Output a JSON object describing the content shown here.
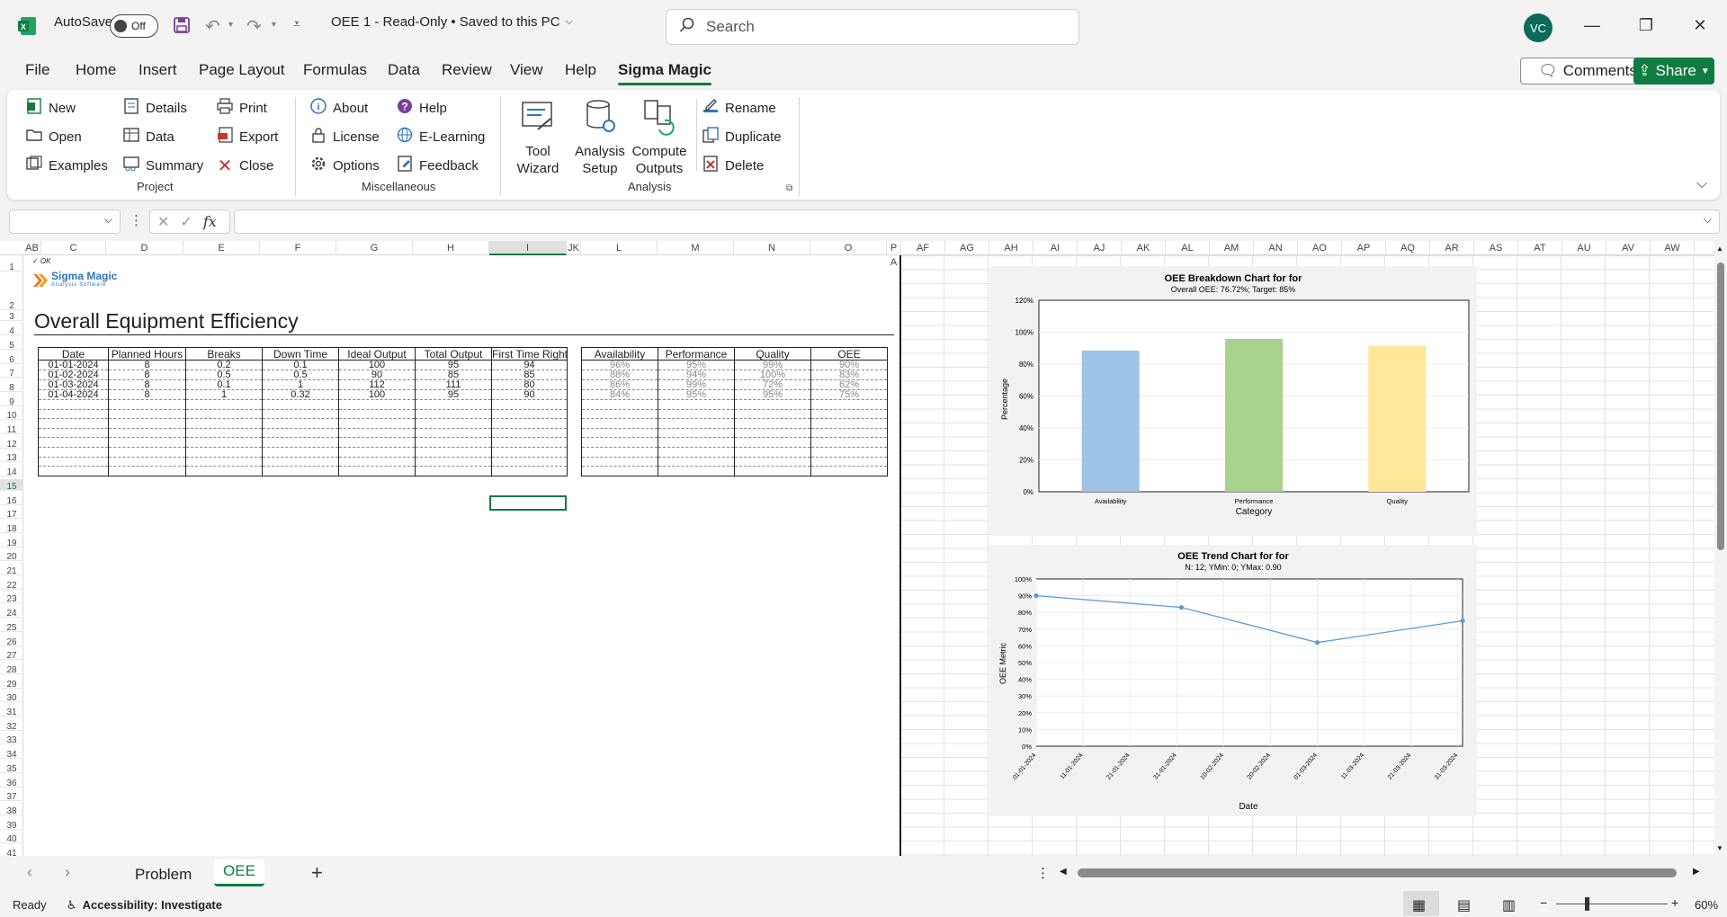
{
  "titlebar": {
    "autosave_label": "AutoSave",
    "autosave_state": "Off",
    "file_title": "OEE 1  -  Read-Only • Saved to this PC",
    "search_placeholder": "Search",
    "user_initials": "VC"
  },
  "menu": {
    "items": [
      "File",
      "Home",
      "Insert",
      "Page Layout",
      "Formulas",
      "Data",
      "Review",
      "View",
      "Help",
      "Sigma Magic"
    ],
    "active": "Sigma Magic",
    "comments_label": "Comments",
    "share_label": "Share"
  },
  "ribbon": {
    "project": {
      "label": "Project",
      "new": "New",
      "open": "Open",
      "examples": "Examples",
      "details": "Details",
      "data": "Data",
      "summary": "Summary",
      "print": "Print",
      "export": "Export",
      "close": "Close"
    },
    "misc": {
      "label": "Miscellaneous",
      "about": "About",
      "license": "License",
      "options": "Options",
      "help": "Help",
      "elearning": "E-Learning",
      "feedback": "Feedback"
    },
    "analysis": {
      "label": "Analysis",
      "tool_wizard_1": "Tool",
      "tool_wizard_2": "Wizard",
      "analysis_setup_1": "Analysis",
      "analysis_setup_2": "Setup",
      "compute_outputs_1": "Compute",
      "compute_outputs_2": "Outputs",
      "rename": "Rename",
      "duplicate": "Duplicate",
      "delete": "Delete"
    }
  },
  "formula_bar": {
    "fx": "fx",
    "name_box": "",
    "formula": ""
  },
  "grid": {
    "columns_left": [
      "AB",
      "C",
      "D",
      "E",
      "F",
      "G",
      "H",
      "I",
      "JK",
      "L",
      "M",
      "N",
      "O",
      "P A"
    ],
    "columns_right": [
      "AF",
      "AG",
      "AH",
      "AI",
      "AJ",
      "AK",
      "AL",
      "AM",
      "AN",
      "AO",
      "AP",
      "AQ",
      "AR",
      "AS",
      "AT",
      "AU",
      "AV",
      "AW"
    ],
    "rows": [
      "1",
      "2",
      "3",
      "4",
      "5",
      "6",
      "7",
      "8",
      "9",
      "10",
      "11",
      "12",
      "13",
      "14",
      "15",
      "16",
      "17",
      "18",
      "19",
      "20",
      "21",
      "22",
      "23",
      "24",
      "25",
      "26",
      "27",
      "28",
      "29",
      "30",
      "31",
      "32",
      "33",
      "34",
      "35",
      "36",
      "37",
      "38",
      "39",
      "40",
      "41"
    ],
    "ok_mark": "✓ OK",
    "logo_name": "Sigma Magic",
    "logo_sub": "Analysis Software",
    "title": "Overall Equipment Efficiency"
  },
  "input_table": {
    "headers": [
      "Date",
      "Planned Hours",
      "Breaks",
      "Down Time",
      "Ideal Output",
      "Total Output",
      "First Time Right"
    ],
    "rows": [
      [
        "01-01-2024",
        "8",
        "0.2",
        "0.1",
        "100",
        "95",
        "94"
      ],
      [
        "01-02-2024",
        "8",
        "0.5",
        "0.5",
        "90",
        "85",
        "85"
      ],
      [
        "01-03-2024",
        "8",
        "0.1",
        "1",
        "112",
        "111",
        "80"
      ],
      [
        "01-04-2024",
        "8",
        "1",
        "0.32",
        "100",
        "95",
        "90"
      ]
    ]
  },
  "output_table": {
    "headers": [
      "Availability",
      "Performance",
      "Quality",
      "OEE"
    ],
    "rows": [
      [
        "96%",
        "95%",
        "99%",
        "90%"
      ],
      [
        "88%",
        "94%",
        "100%",
        "83%"
      ],
      [
        "86%",
        "99%",
        "72%",
        "62%"
      ],
      [
        "84%",
        "95%",
        "95%",
        "75%"
      ]
    ]
  },
  "chart_data": [
    {
      "type": "bar",
      "title": "OEE Breakdown Chart for for",
      "subtitle": "Overall OEE: 76.72%; Target: 85%",
      "categories": [
        "Availability",
        "Performance",
        "Quality"
      ],
      "values": [
        88.5,
        95.75,
        91.5
      ],
      "colors": [
        "#9dc3e6",
        "#a9d18e",
        "#ffe699"
      ],
      "xlabel": "Category",
      "ylabel": "Percentage",
      "yticks": [
        "0%",
        "20%",
        "40%",
        "60%",
        "80%",
        "100%",
        "120%"
      ],
      "ylim": [
        0,
        120
      ]
    },
    {
      "type": "line",
      "title": "OEE Trend Chart for for",
      "subtitle": "N: 12; YMin: 0; YMax: 0.90",
      "x": [
        "01-01-2024",
        "01-02-2024",
        "01-03-2024",
        "01-04-2024"
      ],
      "values": [
        0.9,
        0.83,
        0.62,
        0.75
      ],
      "color": "#5b9bd5",
      "xlabel": "Date",
      "ylabel": "OEE Metric",
      "xticks": [
        "01-01-2024",
        "11-01-2024",
        "21-01-2024",
        "31-01-2024",
        "10-02-2024",
        "20-02-2024",
        "01-03-2024",
        "11-03-2024",
        "21-03-2024",
        "31-03-2024"
      ],
      "yticks": [
        "0%",
        "10%",
        "20%",
        "30%",
        "40%",
        "50%",
        "60%",
        "70%",
        "80%",
        "90%",
        "100%"
      ],
      "ylim": [
        0,
        1
      ]
    }
  ],
  "sheets": {
    "tabs": [
      "Problem",
      "OEE"
    ],
    "active": "OEE",
    "add": "+"
  },
  "status": {
    "ready": "Ready",
    "accessibility": "Accessibility: Investigate",
    "zoom": "60%",
    "minus": "−",
    "plus": "+"
  }
}
